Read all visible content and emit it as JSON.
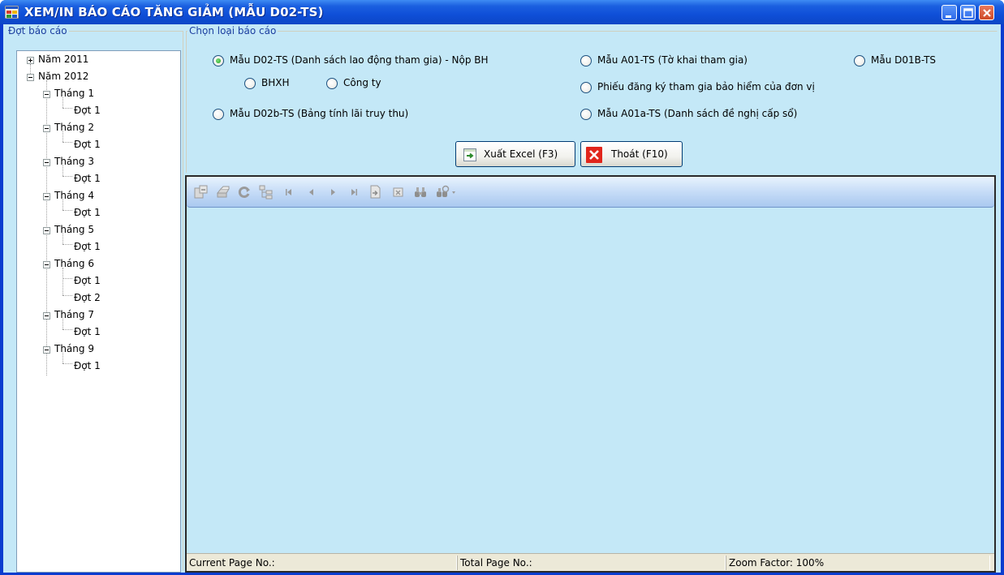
{
  "window": {
    "title": "XEM/IN BÁO CÁO TĂNG GIẢM (MẪU D02-TS)"
  },
  "tree_group": {
    "legend": "Đợt báo cáo",
    "nodes": [
      {
        "label": "Năm 2011"
      },
      {
        "label": "Năm 2012"
      },
      {
        "label": "Tháng 1"
      },
      {
        "label": "Đợt 1"
      },
      {
        "label": "Tháng 2"
      },
      {
        "label": "Đợt 1"
      },
      {
        "label": "Tháng 3"
      },
      {
        "label": "Đợt 1"
      },
      {
        "label": "Tháng 4"
      },
      {
        "label": "Đợt 1"
      },
      {
        "label": "Tháng 5"
      },
      {
        "label": "Đợt 1"
      },
      {
        "label": "Tháng 6"
      },
      {
        "label": "Đợt 1"
      },
      {
        "label": "Đợt 2"
      },
      {
        "label": "Tháng 7"
      },
      {
        "label": "Đợt 1"
      },
      {
        "label": "Tháng 9"
      },
      {
        "label": "Đợt 1"
      }
    ]
  },
  "report_group": {
    "legend": "Chọn loại báo cáo",
    "options": [
      {
        "label": "Mẫu D02-TS (Danh sách lao động tham gia) - Nộp BH",
        "selected": true
      },
      {
        "label": "BHXH",
        "selected": false
      },
      {
        "label": "Công ty",
        "selected": false
      },
      {
        "label": "Mẫu D02b-TS (Bảng tính lãi truy thu)",
        "selected": false
      },
      {
        "label": "Mẫu A01-TS (Tờ khai tham gia)",
        "selected": false
      },
      {
        "label": "Phiếu đăng ký tham gia bảo hiểm của đơn vị",
        "selected": false
      },
      {
        "label": "Mẫu A01a-TS (Danh sách đề nghị cấp sổ)",
        "selected": false
      },
      {
        "label": "Mẫu D01B-TS",
        "selected": false
      }
    ]
  },
  "buttons": {
    "export_label": "Xuất Excel (F3)",
    "exit_label": "Thoát (F10)"
  },
  "viewer": {
    "toolbar_icons": [
      "export-icon",
      "print-icon",
      "refresh-icon",
      "group-tree-icon",
      "first-page-icon",
      "previous-page-icon",
      "next-page-icon",
      "last-page-icon",
      "go-to-page-icon",
      "stop-icon",
      "search-icon",
      "zoom-icon"
    ],
    "status": {
      "current_page": "Current Page No.:",
      "total_page": "Total Page No.:",
      "zoom": "Zoom Factor: 100%"
    }
  },
  "colors": {
    "client_bg": "#c4e8f7",
    "title_bar": "#0f4fd8",
    "legend_text": "#1c3fa0"
  }
}
